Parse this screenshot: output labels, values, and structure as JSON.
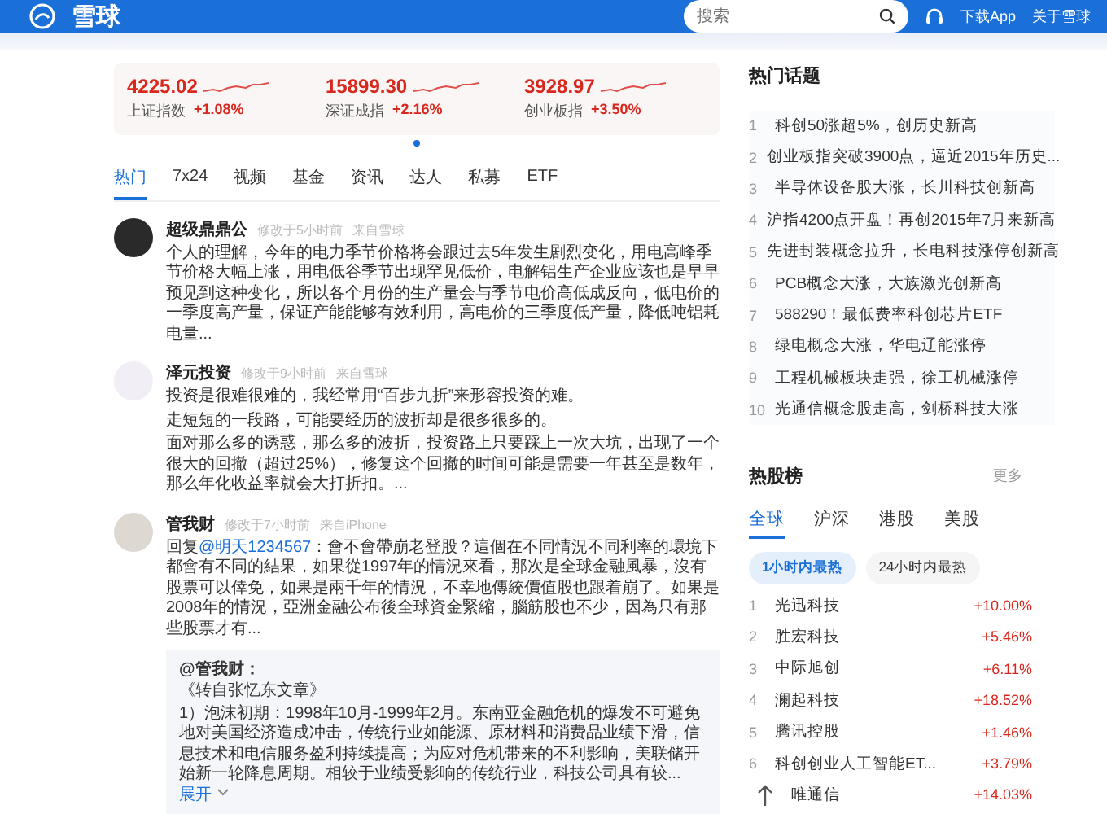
{
  "header": {
    "logo": "雪球",
    "search": {
      "placeholder": "搜索"
    },
    "links": [
      "下载App",
      "关于雪球"
    ]
  },
  "indices": [
    {
      "value": "4225.02",
      "name": "上证指数",
      "change": "+1.08%"
    },
    {
      "value": "15899.30",
      "name": "深证成指",
      "change": "+2.16%"
    },
    {
      "value": "3928.97",
      "name": "创业板指",
      "change": "+3.50%"
    }
  ],
  "tabs": [
    {
      "label": "热门",
      "selected": true
    },
    {
      "label": "7x24",
      "selected": false
    },
    {
      "label": "视频",
      "selected": false
    },
    {
      "label": "基金",
      "selected": false
    },
    {
      "label": "资讯",
      "selected": false
    },
    {
      "label": "达人",
      "selected": false
    },
    {
      "label": "私募",
      "selected": false
    },
    {
      "label": "ETF",
      "selected": false
    }
  ],
  "posts": [
    {
      "author": "超级鼎鼎公",
      "meta": [
        "修改于5小时前",
        "来自雪球"
      ],
      "text": "个人的理解，今年的电力季节价格将会跟过去5年发生剧烈变化，用电高峰季节价格大幅上涨，用电低谷季节出现罕见低价，电解铝生产企业应该也是早早预见到这种变化，所以各个月份的生产量会与季节电价高低成反向，低电价的一季度高产量，保证产能能够有效利用，高电价的三季度低产量，降低吨铝耗电量..."
    },
    {
      "author": "泽元投资",
      "meta": [
        "修改于9小时前",
        "来自雪球"
      ],
      "lines": [
        "投资是很难很难的，我经常用“百步九折”来形容投资的难。",
        "走短短的一段路，可能要经历的波折却是很多很多的。",
        "面对那么多的诱惑，那么多的波折，投资路上只要踩上一次大坑，出现了一个很大的回撤（超过25%），修复这个回撤的时间可能是需要一年甚至是数年，那么年化收益率就会大打折扣。..."
      ]
    },
    {
      "author": "管我财",
      "meta": [
        "修改于7小时前",
        "来自iPhone"
      ],
      "reply": {
        "prefix": "回复",
        "mention": "@明天1234567",
        "text": "：會不會帶崩老登股？這個在不同情況不同利率的環境下都會有不同的結果，如果從1997年的情況來看，那次是全球金融風暴，沒有股票可以倖免，如果是兩千年的情況，不幸地傳統價值股也跟着崩了。如果是2008年的情況，亞洲金融公布後全球資金緊縮，腦筋股也不少，因為只有那些股票才有..."
      },
      "quote": {
        "author": "@管我财：",
        "source": "《转自张忆东文章》",
        "text": "1）泡沫初期：1998年10月-1999年2月。东南亚金融危机的爆发不可避免地对美国经济造成冲击，传统行业如能源、原材料和消费品业绩下滑，信息技术和电信服务盈利持续提高；为应对危机带来的不利影响，美联储开始新一轮降息周期。相较于业绩受影响的传统行业，科技公司具有较...",
        "more": "展开"
      }
    }
  ],
  "hot_topics": {
    "title": "热门话题",
    "items": [
      {
        "rank": "1",
        "text": "科创50涨超5%，创历史新高"
      },
      {
        "rank": "2",
        "text": "创业板指突破3900点，逼近2015年历史..."
      },
      {
        "rank": "3",
        "text": "半导体设备股大涨，长川科技创新高"
      },
      {
        "rank": "4",
        "text": "沪指4200点开盘！再创2015年7月来新高"
      },
      {
        "rank": "5",
        "text": "先进封装概念拉升，长电科技涨停创新高"
      },
      {
        "rank": "6",
        "text": "PCB概念大涨，大族激光创新高"
      },
      {
        "rank": "7",
        "text": "588290！最低费率科创芯片ETF"
      },
      {
        "rank": "8",
        "text": "绿电概念大涨，华电辽能涨停"
      },
      {
        "rank": "9",
        "text": "工程机械板块走强，徐工机械涨停"
      },
      {
        "rank": "10",
        "text": "光通信概念股走高，剑桥科技大涨"
      }
    ]
  },
  "hot_stocks": {
    "title": "热股榜",
    "more": "更多",
    "tabs": [
      {
        "label": "全球",
        "selected": true
      },
      {
        "label": "沪深",
        "selected": false
      },
      {
        "label": "港股",
        "selected": false
      },
      {
        "label": "美股",
        "selected": false
      }
    ],
    "periods": [
      {
        "label": "1小时内最热",
        "selected": true
      },
      {
        "label": "24小时内最热",
        "selected": false
      }
    ],
    "rows": [
      {
        "rank": "1",
        "name": "光迅科技",
        "change": "+10.00%"
      },
      {
        "rank": "2",
        "name": "胜宏科技",
        "change": "+5.46%"
      },
      {
        "rank": "3",
        "name": "中际旭创",
        "change": "+6.11%"
      },
      {
        "rank": "4",
        "name": "澜起科技",
        "change": "+18.52%"
      },
      {
        "rank": "5",
        "name": "腾讯控股",
        "change": "+1.46%"
      },
      {
        "rank": "6",
        "name": "科创创业人工智能ET...",
        "change": "+3.79%"
      },
      {
        "name": "唯通信",
        "change": "+14.03%"
      }
    ]
  }
}
